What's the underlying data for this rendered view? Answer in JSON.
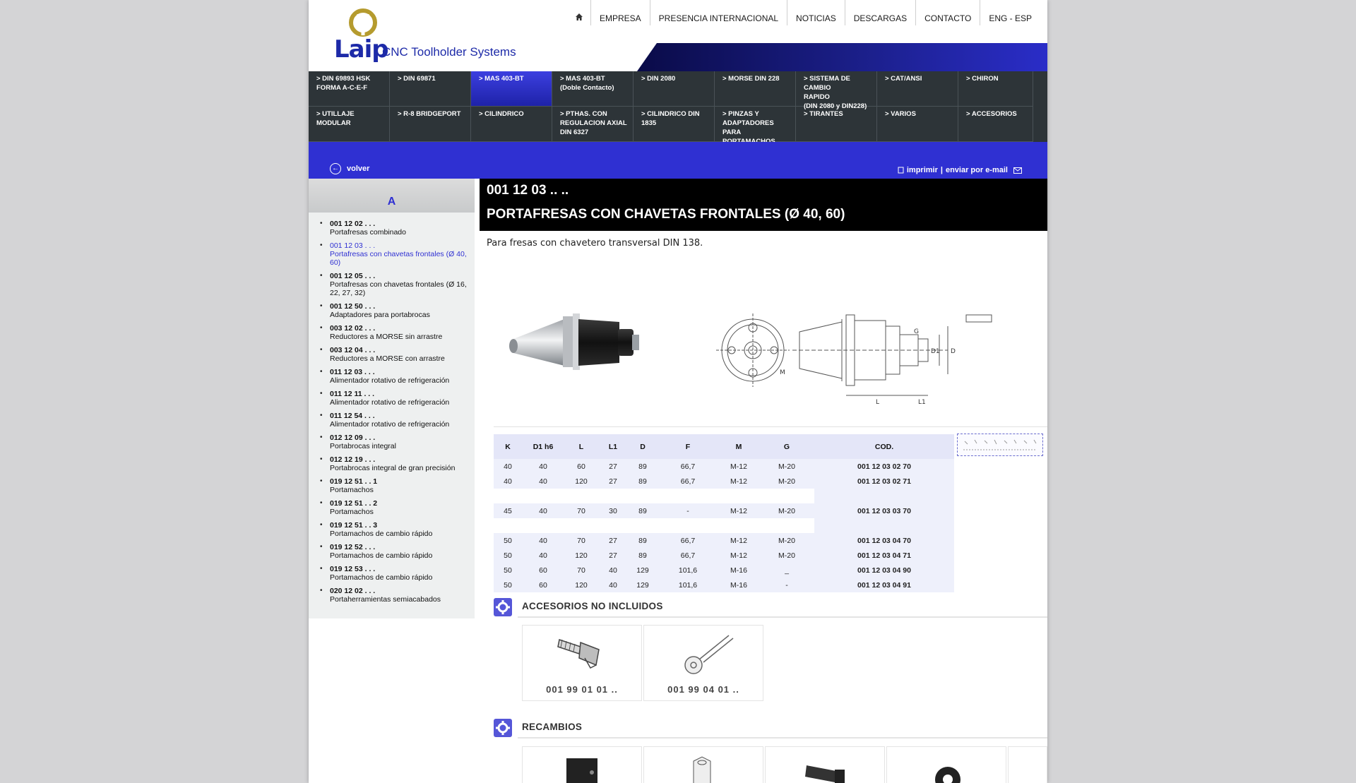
{
  "brand": {
    "name": "Laip",
    "tagline": "CNC Toolholder Systems",
    "accent": "#2f30d2",
    "logo_gold": "#b59b2e"
  },
  "topnav": {
    "home_icon": "home-icon",
    "items": [
      "EMPRESA",
      "PRESENCIA INTERNACIONAL",
      "NOTICIAS",
      "DESCARGAS",
      "CONTACTO",
      "ENG - ESP"
    ]
  },
  "mega_menu": [
    "> DIN 69893 HSK\n   FORMA A-C-E-F",
    "> DIN 69871",
    "> MAS 403-BT",
    "> MAS 403-BT\n   (Doble Contacto)",
    "> DIN 2080",
    "> MORSE DIN 228",
    "> SISTEMA DE CAMBIO\n   RAPIDO\n   (DIN 2080 y DIN228)",
    "> CAT/ANSI",
    "> CHIRON",
    "> UTILLAJE MODULAR",
    "> R-8 BRIDGEPORT",
    "> CILINDRICO",
    "> PTHAS. CON\n   REGULACION AXIAL\n   DIN 6327",
    "> CILINDRICO DIN 1835",
    "> PINZAS Y\n   ADAPTADORES PARA\n   PORTAMACHOS",
    "> TIRANTES",
    "> VARIOS",
    "> ACCESORIOS"
  ],
  "band": {
    "back_label": "volver",
    "print_label": "imprimir",
    "separator": "|",
    "email_label": "enviar por e-mail"
  },
  "sidebar": {
    "letter": "A",
    "items": [
      {
        "code": "001 12 02 . . .",
        "desc": "Portafresas combinado"
      },
      {
        "code": "001 12 03 . . .",
        "desc": "Portafresas con chavetas frontales (Ø 40, 60)"
      },
      {
        "code": "001 12 05 . . .",
        "desc": "Portafresas con chavetas frontales (Ø 16, 22, 27, 32)"
      },
      {
        "code": "001 12 50 . . .",
        "desc": "Adaptadores para portabrocas"
      },
      {
        "code": "003 12 02 . . .",
        "desc": "Reductores a MORSE sin arrastre"
      },
      {
        "code": "003 12 04 . . .",
        "desc": "Reductores a MORSE con arrastre"
      },
      {
        "code": "011 12 03 . . .",
        "desc": "Alimentador rotativo de refrigeración"
      },
      {
        "code": "011 12 11 . . .",
        "desc": "Alimentador rotativo de refrigeración"
      },
      {
        "code": "011 12 54 . . .",
        "desc": "Alimentador rotativo de refrigeración"
      },
      {
        "code": "012 12 09 . . .",
        "desc": "Portabrocas integral"
      },
      {
        "code": "012 12 19 . . .",
        "desc": "Portabrocas integral de gran precisión"
      },
      {
        "code": "019 12 51 . . 1",
        "desc": "Portamachos"
      },
      {
        "code": "019 12 51 . . 2",
        "desc": "Portamachos"
      },
      {
        "code": "019 12 51 . . 3",
        "desc": "Portamachos de cambio rápido"
      },
      {
        "code": "019 12 52 . . .",
        "desc": "Portamachos de cambio rápido"
      },
      {
        "code": "019 12 53 . . .",
        "desc": "Portamachos de cambio rápido"
      },
      {
        "code": "020 12 02 . . .",
        "desc": "Portaherramientas semiacabados"
      }
    ]
  },
  "product": {
    "code": "001 12 03 .. ..",
    "title": "PORTAFRESAS CON CHAVETAS FRONTALES (Ø 40, 60)",
    "description": "Para fresas con chavetero transversal DIN 138.",
    "drawing_labels": [
      "L",
      "L1",
      "D1",
      "D",
      "G",
      "M"
    ]
  },
  "spec_table": {
    "headers": [
      "K",
      "D1 h6",
      "L",
      "L1",
      "D",
      "F",
      "M",
      "G",
      "COD."
    ],
    "rows": [
      [
        "40",
        "40",
        "60",
        "27",
        "89",
        "66,7",
        "M-12",
        "M-20",
        "001 12 03 02 70"
      ],
      [
        "40",
        "40",
        "120",
        "27",
        "89",
        "66,7",
        "M-12",
        "M-20",
        "001 12 03 02 71"
      ],
      null,
      [
        "45",
        "40",
        "70",
        "30",
        "89",
        "-",
        "M-12",
        "M-20",
        "001 12 03 03 70"
      ],
      null,
      [
        "50",
        "40",
        "70",
        "27",
        "89",
        "66,7",
        "M-12",
        "M-20",
        "001 12 03 04 70"
      ],
      [
        "50",
        "40",
        "120",
        "27",
        "89",
        "66,7",
        "M-12",
        "M-20",
        "001 12 03 04 71"
      ],
      [
        "50",
        "60",
        "70",
        "40",
        "129",
        "101,6",
        "M-16",
        "_",
        "001 12 03 04 90"
      ],
      [
        "50",
        "60",
        "120",
        "40",
        "129",
        "101,6",
        "M-16",
        "-",
        "001 12 03 04 91"
      ]
    ]
  },
  "accessories": {
    "title": "ACCESORIOS NO INCLUIDOS",
    "items": [
      "001 99 01 01 ..",
      "001 99 04 01 .."
    ]
  },
  "spares": {
    "title": "RECAMBIOS"
  }
}
